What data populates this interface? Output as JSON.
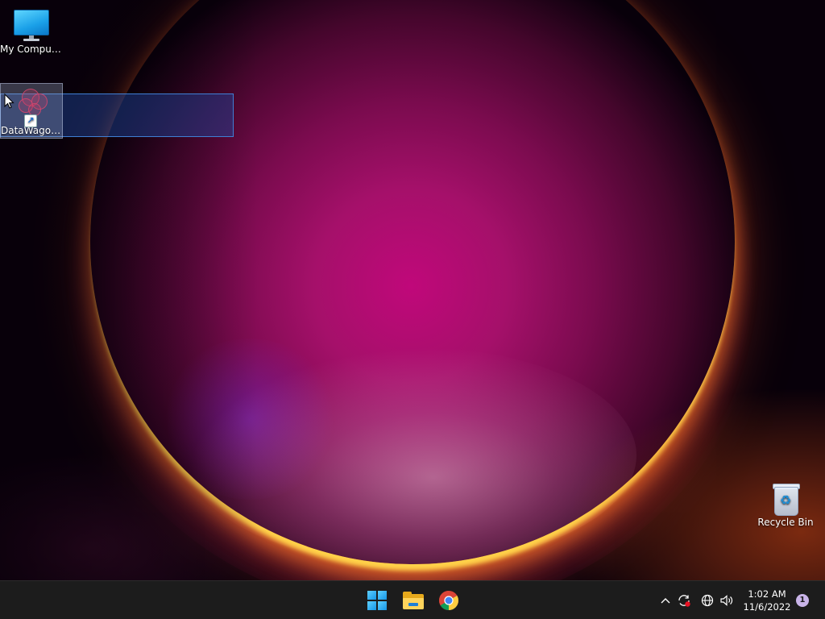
{
  "desktop": {
    "icons": [
      {
        "label": "My Computer",
        "icon": "monitor-icon"
      },
      {
        "label": "DataWagon...",
        "icon": "datawagon-icon",
        "selected": true,
        "shortcut": true
      },
      {
        "label": "Recycle Bin",
        "icon": "recycle-bin-icon"
      }
    ]
  },
  "taskbar": {
    "pinned": [
      {
        "name": "Start",
        "icon": "windows-logo-icon"
      },
      {
        "name": "File Explorer",
        "icon": "folder-icon"
      },
      {
        "name": "Google Chrome",
        "icon": "chrome-icon"
      }
    ],
    "tray": {
      "overflow_glyph": "^",
      "time": "1:02 AM",
      "date": "11/6/2022",
      "notification_count": "1"
    }
  },
  "colors": {
    "taskbar_bg": "#1c1c1c",
    "selection_fill": "#1e46a0",
    "selection_border": "#3f7fd4",
    "accent_blue": "#1596e6"
  }
}
